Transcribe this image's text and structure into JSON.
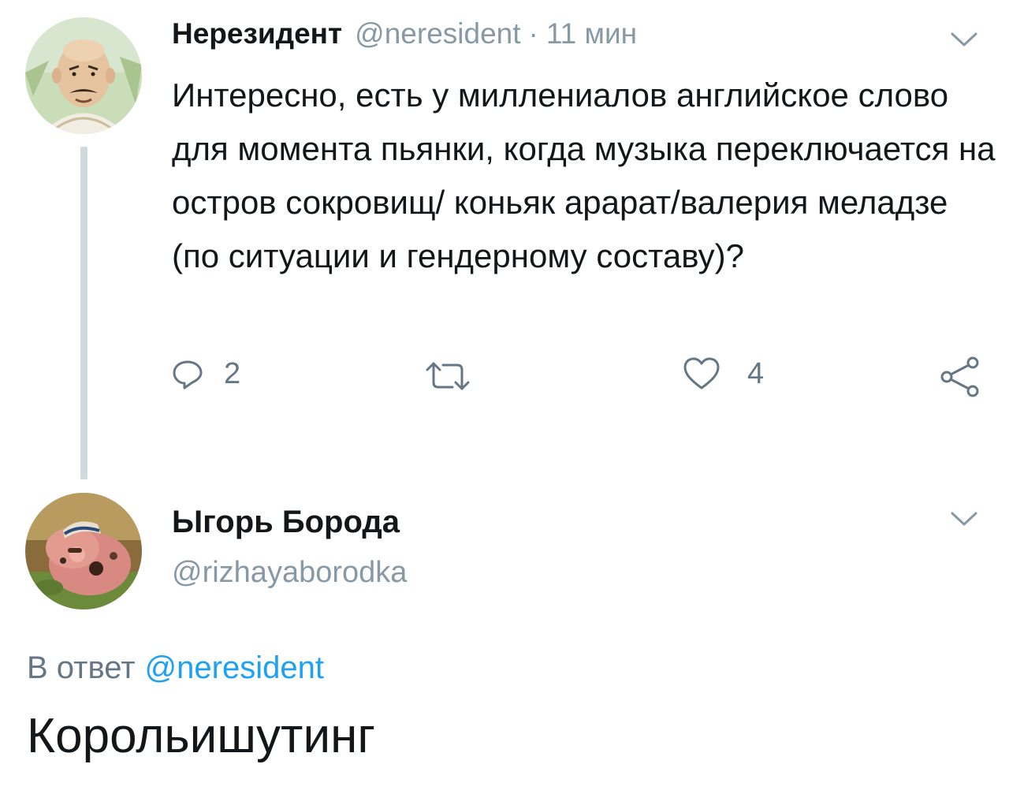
{
  "tweet1": {
    "author_name": "Нерезидент",
    "author_handle": "@neresident",
    "separator": "·",
    "time": "11 мин",
    "text": "Интересно, есть у миллениалов английское слово для момента пьянки, когда музыка переключается на остров сокровищ/ коньяк арарат/валерия меладзе (по ситуации и гендерному составу)?",
    "reply_count": "2",
    "retweet_count": "",
    "like_count": "4",
    "avatar_icon": "avatar-cartoon-man-icon",
    "menu_icon": "chevron-down-icon"
  },
  "tweet2": {
    "author_name": "Ыгорь Борода",
    "author_handle": "@rizhayaborodka",
    "reply_prefix": "В ответ",
    "reply_mention": "@neresident",
    "text": "Корольишутинг",
    "avatar_icon": "avatar-cartoon-character-icon",
    "menu_icon": "chevron-down-icon"
  },
  "colors": {
    "text": "#14171a",
    "secondary": "#8899a6",
    "action": "#657786",
    "link": "#1da1f2",
    "thread_line": "#cfd9de"
  }
}
